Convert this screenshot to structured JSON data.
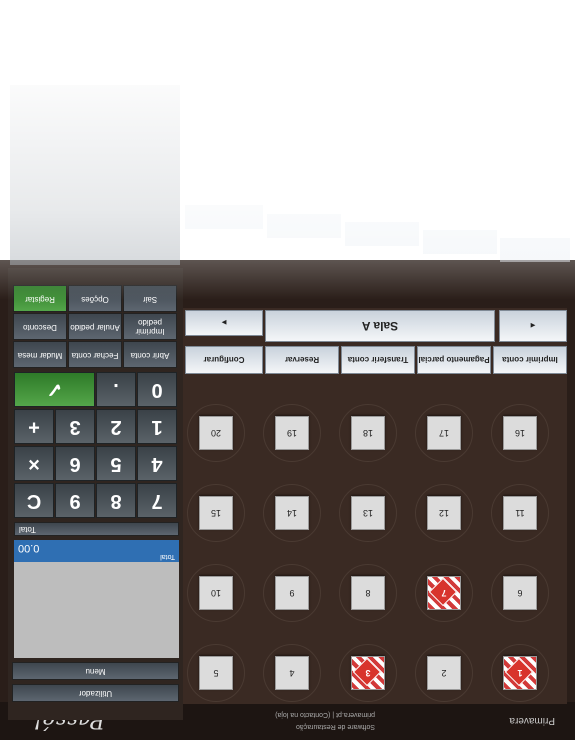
{
  "app": {
    "brand": "Passé!",
    "vendor": "Primavera",
    "footer_line1": "Software de Restauração",
    "footer_line2": "primavera.pt | (Contacto na loja)"
  },
  "room": {
    "name": "Sala A",
    "prev_arrow": "◄",
    "next_arrow": "►"
  },
  "actions": {
    "reprint_ticket": "Imprimir conta",
    "partial_payment": "Pagamento parcial",
    "transfer_account": "Transferir conta",
    "reserve": "Reservar",
    "configure": "Configurar"
  },
  "tables": [
    {
      "n": "1",
      "busy": true
    },
    {
      "n": "2",
      "busy": false
    },
    {
      "n": "3",
      "busy": true
    },
    {
      "n": "4",
      "busy": false
    },
    {
      "n": "5",
      "busy": false
    },
    {
      "n": "6",
      "busy": false
    },
    {
      "n": "7",
      "busy": true
    },
    {
      "n": "8",
      "busy": false
    },
    {
      "n": "9",
      "busy": false
    },
    {
      "n": "10",
      "busy": false
    },
    {
      "n": "11",
      "busy": false
    },
    {
      "n": "12",
      "busy": false
    },
    {
      "n": "13",
      "busy": false
    },
    {
      "n": "14",
      "busy": false
    },
    {
      "n": "15",
      "busy": false
    },
    {
      "n": "16",
      "busy": false
    },
    {
      "n": "17",
      "busy": false
    },
    {
      "n": "18",
      "busy": false
    },
    {
      "n": "19",
      "busy": false
    },
    {
      "n": "20",
      "busy": false
    }
  ],
  "left": {
    "user_label": "Utilizador",
    "menu_label": "Menu",
    "display_label": "Total",
    "display_value": "0.00",
    "subtotal_label": "Total",
    "keys": [
      "7",
      "8",
      "9",
      "C",
      "4",
      "5",
      "6",
      "×",
      "1",
      "2",
      "3",
      "+",
      "0",
      ".",
      "✓"
    ],
    "side_buttons": [
      {
        "label": "Abrir conta"
      },
      {
        "label": "Fechar conta"
      },
      {
        "label": "Mudar mesa"
      },
      {
        "label": "Imprimir pedido"
      },
      {
        "label": "Anular pedido"
      },
      {
        "label": "Desconto"
      },
      {
        "label": "Sair"
      },
      {
        "label": "Opções"
      },
      {
        "label": "Registar"
      }
    ]
  },
  "colors": {
    "accent": "#2f6fb3",
    "busy": "#d8342c",
    "ok": "#3c8f34",
    "frame": "#2a1e19"
  }
}
